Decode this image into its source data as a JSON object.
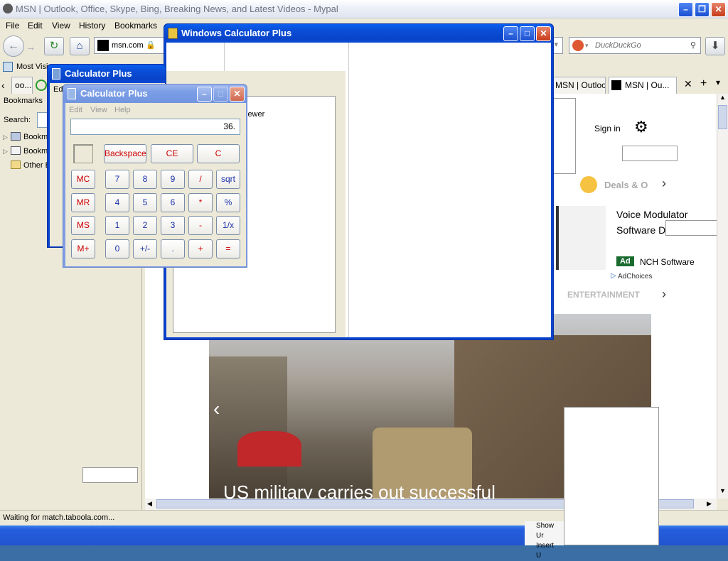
{
  "browser": {
    "title": "MSN | Outlook, Office, Skype, Bing, Breaking News, and Latest Videos - Mypal",
    "menu": [
      "File",
      "Edit",
      "View",
      "History",
      "Bookmarks"
    ],
    "url": "msn.com",
    "search_placeholder": "DuckDuckGo",
    "bookmarks_toolbar_item": "Most Visi",
    "tabs": [
      "oo...",
      "MSN | Outloo...",
      "MSN | Ou..."
    ],
    "status": "Waiting for match.taboola.com..."
  },
  "sidebar": {
    "title": "Bookmarks",
    "search_label": "Search:",
    "items": [
      "Bookm",
      "Bookm",
      "Other B"
    ]
  },
  "msn": {
    "sign_in": "Sign in",
    "deals_label": "Deals & O",
    "ad_title_line1": "Voice Modulator",
    "ad_title_line2": "Software D",
    "ad_badge": "Ad",
    "ad_sponsor": "NCH Software",
    "adchoices": "AdChoices",
    "entertainment": "ENTERTAINMENT",
    "headline": "US military carries out successful"
  },
  "windows_calc": {
    "title": "Windows Calculator Plus",
    "partial_text": "iewer"
  },
  "calc_back": {
    "title": "Calculator Plus",
    "menu_partial": "Edi"
  },
  "calc_front": {
    "title": "Calculator Plus",
    "menu": [
      "Edit",
      "View",
      "Help"
    ],
    "display": "36.",
    "keys": {
      "backspace": "Backspace",
      "ce": "CE",
      "c": "C",
      "mc": "MC",
      "mr": "MR",
      "ms": "MS",
      "mplus": "M+",
      "d7": "7",
      "d8": "8",
      "d9": "9",
      "div": "/",
      "sqrt": "sqrt",
      "d4": "4",
      "d5": "5",
      "d6": "6",
      "mul": "*",
      "pct": "%",
      "d1": "1",
      "d2": "2",
      "d3": "3",
      "sub": "-",
      "inv": "1/x",
      "d0": "0",
      "sign": "+/-",
      "dot": ".",
      "add": "+",
      "eq": "="
    }
  },
  "taskbar_partial": {
    "line1": "Show Ur",
    "line2": "Insert U"
  },
  "colors": {
    "xp_blue": "#0a4fd8",
    "calc_red": "#cc0000",
    "calc_blue": "#1a2fa8"
  }
}
